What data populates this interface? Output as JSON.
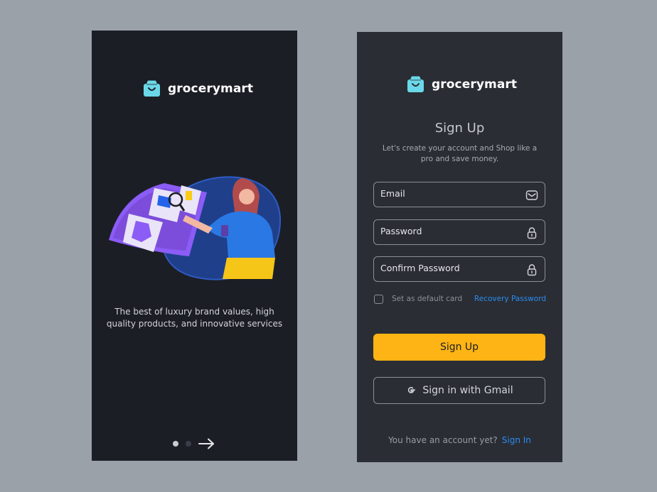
{
  "onboarding": {
    "brand": "grocerymart",
    "caption_line1": "The best of luxury brand values, high",
    "caption_line2": "quality products, and innovative services",
    "pager": {
      "total": 2,
      "active": 1
    },
    "next_icon": "arrow-right-icon",
    "illustration": "woman-browsing-fashion-catalog"
  },
  "signup": {
    "brand": "grocerymart",
    "title": "Sign Up",
    "subtitle_line1": "Let's create your account and  Shop like a",
    "subtitle_line2": "pro and save money.",
    "fields": {
      "email": {
        "label": "Email",
        "icon": "mail-icon"
      },
      "password": {
        "label": "Password",
        "icon": "lock-icon"
      },
      "confirm": {
        "label": "Confirm Password",
        "icon": "lock-icon"
      }
    },
    "checkbox_label": "Set as default card",
    "checkbox_checked": false,
    "recovery_link": "Recovery Password",
    "submit_label": "Sign Up",
    "gmail_label": "Sign in with Gmail",
    "footer_question": "You have an account yet?",
    "footer_link": "Sign In"
  },
  "colors": {
    "background": "#9aa1a8",
    "panel_dark": "#1c1e26",
    "panel_gray": "#2a2d34",
    "brand_cyan": "#6ad8e8",
    "accent_yellow": "#fdb414",
    "link_blue": "#2b8df0"
  }
}
